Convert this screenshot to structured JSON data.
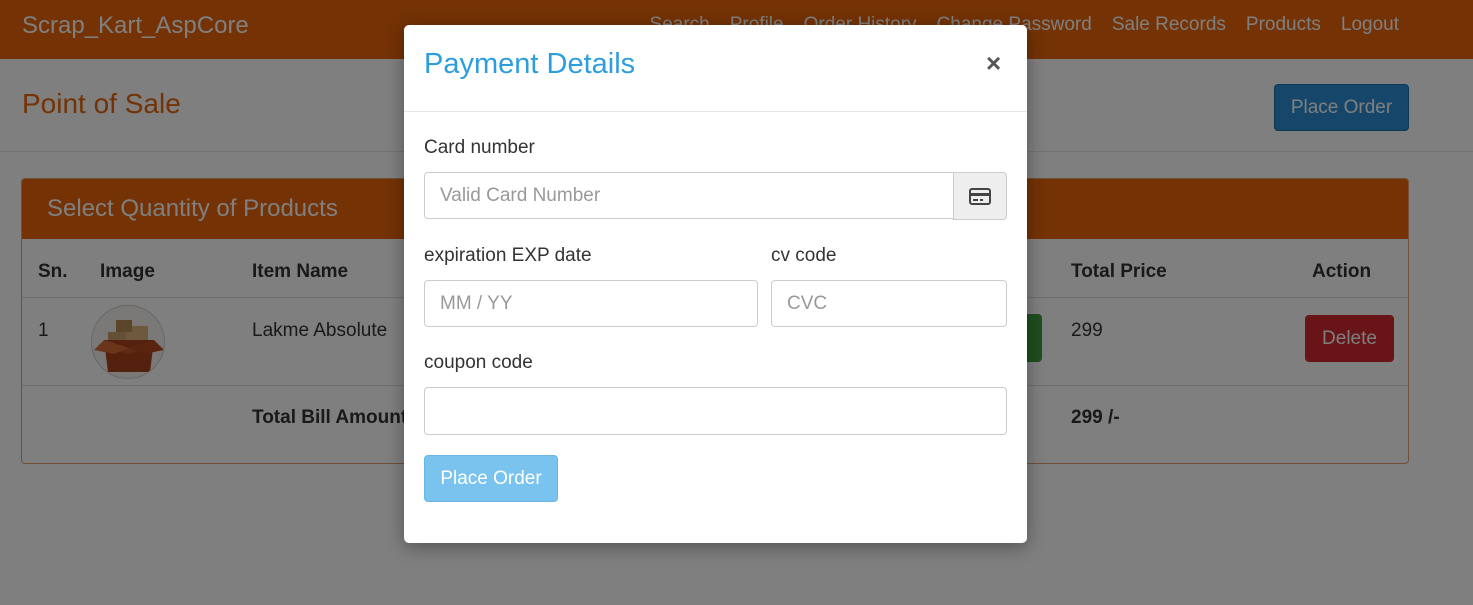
{
  "navbar": {
    "brand": "Scrap_Kart_AspCore",
    "links": [
      "Search",
      "Profile",
      "Order History",
      "Change Password",
      "Sale Records",
      "Products",
      "Logout"
    ]
  },
  "page": {
    "title": "Point of Sale",
    "place_order_label": "Place Order"
  },
  "panel": {
    "heading": "Select Quantity of Products",
    "columns": [
      "Sn.",
      "Image",
      "Item Name",
      "Total Price",
      "Action"
    ],
    "rows": [
      {
        "sn": "1",
        "item_name": "Lakme Absolute",
        "total_price": "299",
        "action_label": "Delete"
      }
    ],
    "total_label": "Total Bill Amount",
    "total_value": "299 /-"
  },
  "modal": {
    "title": "Payment Details",
    "close": "×",
    "card_number_label": "Card number",
    "card_number_placeholder": "Valid Card Number",
    "expiration_label": "expiration EXP date",
    "expiration_placeholder": "MM / YY",
    "cv_label": "cv code",
    "cv_placeholder": "CVC",
    "coupon_label": "coupon code",
    "coupon_value": "",
    "submit_label": "Place Order"
  },
  "icons": {
    "card": "credit-card-icon",
    "product": "cardboard-box-icon"
  },
  "colors": {
    "brand_orange": "#e8650a",
    "primary_blue": "#2c8fd6",
    "modal_title_blue": "#2c9ee0",
    "danger_red": "#d2282e",
    "success_green": "#3f9f3f",
    "disabled_button_blue": "#7ac3ee"
  }
}
